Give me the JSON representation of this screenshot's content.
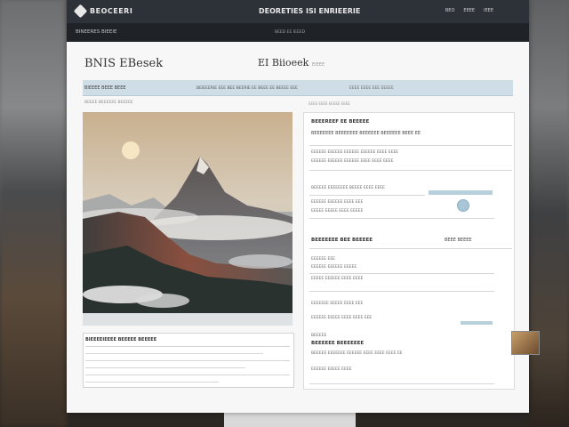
{
  "window": {
    "brand_name": "BEOCEERI",
    "title": "DEORETIES ISI ENRIEERIE",
    "top_links": [
      "BEO",
      "EEEE",
      "IEEE"
    ],
    "sub_left": "BINEERES BIEEIE",
    "sub_mid": "BEED EE IEEED"
  },
  "page": {
    "title": "BNIS EBesek",
    "sub": "EEE",
    "center_title": "EI Biioeek",
    "center_sub": "EIEEE"
  },
  "toolbar": {
    "left": "BIEEEE BEEE BEEE",
    "mid": "BEIEEERIE EEE BEE BEERIE EE BEEE EE BEEEE EEE",
    "right": "EEEE EEEE EEE EEEEE"
  },
  "crumbs": {
    "left": "BEEEE   BEEEEEE BEEEEE",
    "right": "EEEE EEEE EEEEE EEEE"
  },
  "hero": {
    "label": ""
  },
  "bottom_left_card": {
    "title": "BIEEEEIEEEE BEEEEE BEEEEE"
  },
  "right_panel": {
    "heading": "BEEEREEF EE BEEEEE",
    "subheading": "BEEEEEEE BEEEEEEE BEEEEEE BEEEEEE BEEE EE",
    "text_1": "EEEEEE EEEEEE EEEEEE EEEEEE EEEE EEEE",
    "text_2": "EEEEEE EEEEEE EEEEEE EEEE EEEE EEEE",
    "text_3": "EEEEEE EEEEEE EEEE EEEE EEEE",
    "text_4": "BEEEEE EEEEEEEE BEEEE EEEE EEEE",
    "text_5": "EEEEEE EEEEEE EEEE EEE",
    "text_6": "EEEEE EEEEE EEEE EEEEE",
    "section_title": "BEEEEEEE BEE BEEEEE",
    "section_right": "BEEE BEEEE",
    "text_7": "EEEEEE EEE",
    "text_8": "EEEEEE EEEEEE EEEEE",
    "text_9": "EEEEE EEEEEE EEEE EEEE",
    "text_10": "EEEEEEE EEEEE EEEE EEE",
    "text_11": "EEEEEE EEEEE EEEE EEEE EEE",
    "item_title": "BEEEEE",
    "item_name": "BEEEEEE  BEEEEEEE",
    "item_desc": "BEEEEE EEEEEEE EEEEEE EEEE EEEE EEEE EE",
    "item_desc_2": "EEEEEE EEEEE EEEE"
  },
  "colors": {
    "topbar": "#2d3238",
    "subbar": "#1f2327",
    "toolbar": "#cfdde6",
    "accent": "#a9c6d6"
  }
}
